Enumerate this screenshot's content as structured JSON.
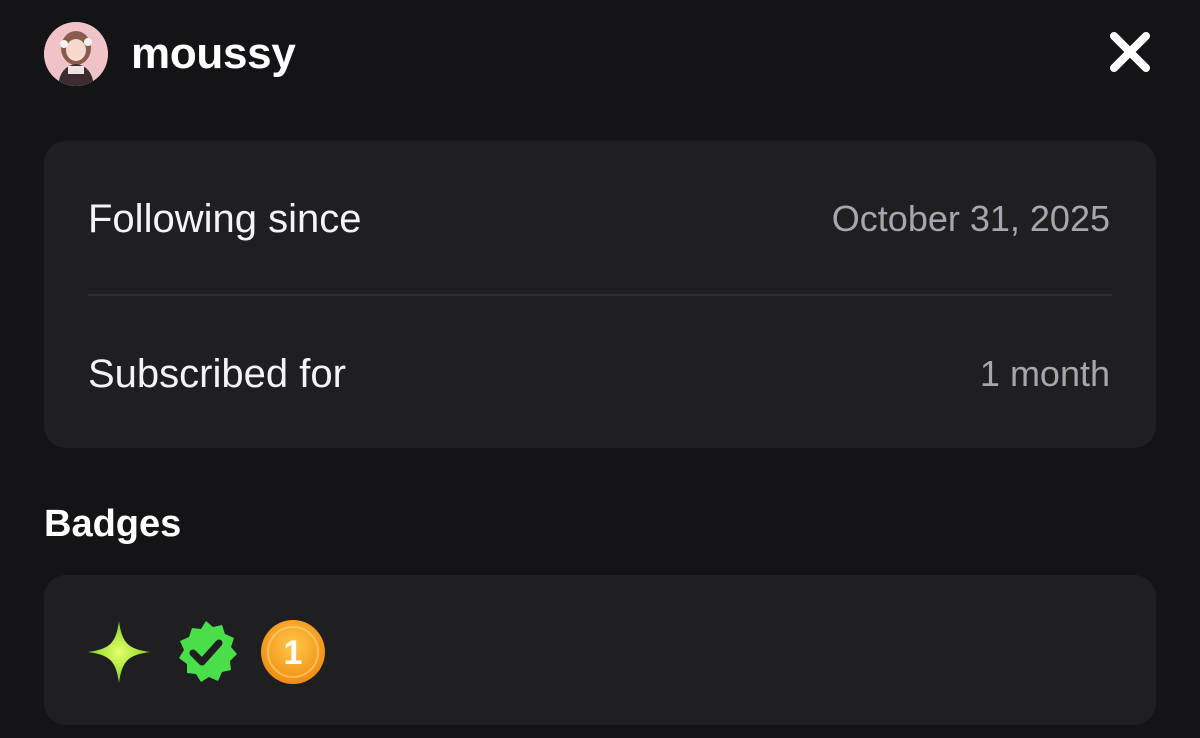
{
  "header": {
    "username": "moussy",
    "avatar_icon": "user-avatar",
    "close_icon": "close-icon"
  },
  "info": {
    "rows": [
      {
        "label": "Following since",
        "value": "October 31, 2025"
      },
      {
        "label": "Subscribed for",
        "value": "1 month"
      }
    ]
  },
  "badges": {
    "title": "Badges",
    "items": [
      {
        "icon": "sparkle-icon",
        "color": "#a6e22e"
      },
      {
        "icon": "verified-check-icon",
        "color": "#4ade4a"
      },
      {
        "icon": "subscriber-one-badge",
        "number": "1",
        "color": "#f5a623"
      }
    ]
  },
  "colors": {
    "background": "#141416",
    "card": "#1f1f22",
    "secondary_text": "#a6a6ad"
  }
}
